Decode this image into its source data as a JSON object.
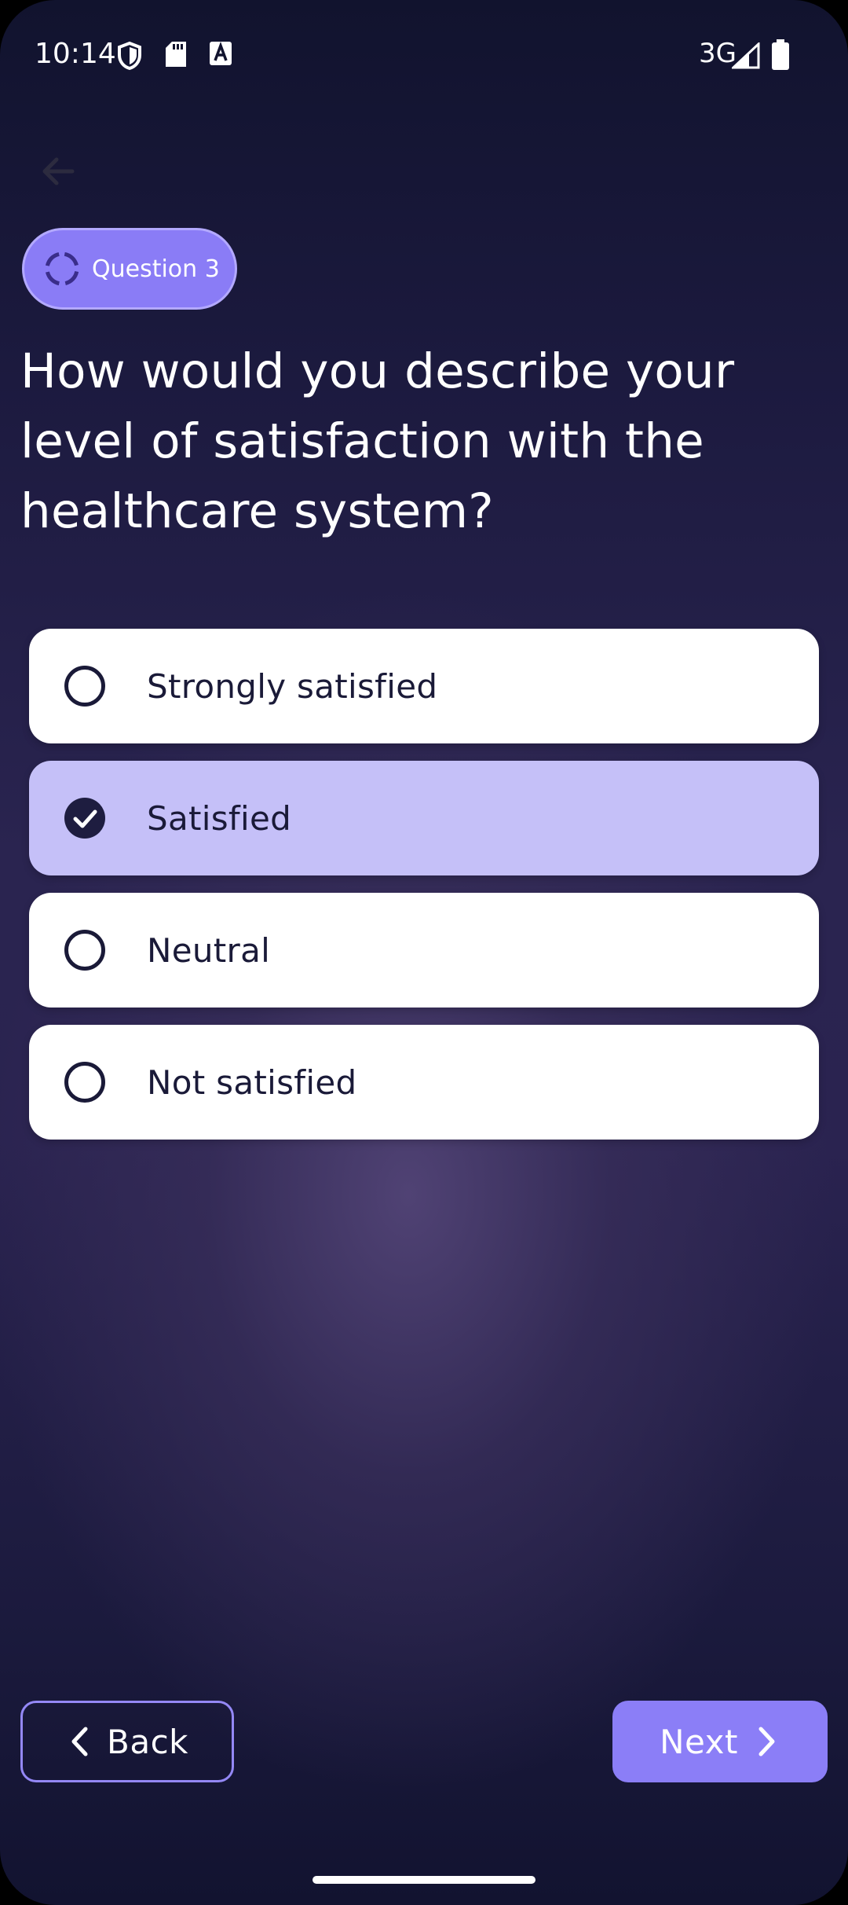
{
  "status_bar": {
    "time": "10:14",
    "network": "3G",
    "icons": [
      "shield-icon",
      "sd-card-icon",
      "font-a-icon",
      "signal-icon",
      "battery-icon"
    ]
  },
  "header": {
    "back_icon": "arrow-left-icon"
  },
  "chip": {
    "label": "Question 3",
    "icon": "loading-ring-icon"
  },
  "question": "How would you describe your level of satisfaction with the healthcare system?",
  "options": [
    {
      "label": "Strongly satisfied",
      "selected": false
    },
    {
      "label": "Satisfied",
      "selected": true
    },
    {
      "label": "Neutral",
      "selected": false
    },
    {
      "label": "Not satisfied",
      "selected": false
    }
  ],
  "footer": {
    "back_label": "Back",
    "next_label": "Next"
  },
  "colors": {
    "accent": "#8b7ef7",
    "selected_option": "#c5c0f8",
    "background": "#1c1a3f"
  }
}
